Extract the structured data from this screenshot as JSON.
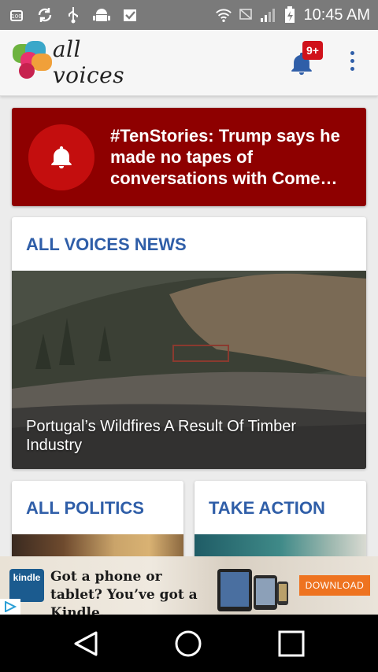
{
  "status_bar": {
    "time": "10:45 AM",
    "left_icons": [
      "battery-100-icon",
      "sync-icon",
      "usb-icon",
      "android-debug-icon",
      "clipboard-check-icon"
    ],
    "right_icons": [
      "wifi-icon",
      "no-sim-icon",
      "signal-icon",
      "battery-charging-icon"
    ]
  },
  "app_bar": {
    "logo_text": "all voices",
    "notification_badge": "9+"
  },
  "breaking": {
    "headline": "#TenStories: Trump says he made no tapes of conversations with Come…"
  },
  "sections": {
    "news": {
      "title": "ALL VOICES NEWS",
      "caption": "Portugal’s Wildfires A Result Of Timber Industry"
    },
    "politics": {
      "title": "ALL POLITICS"
    },
    "action": {
      "title": "TAKE ACTION"
    }
  },
  "ad": {
    "brand": "kindle",
    "text": "Got a phone or tablet? You’ve got a Kindle.",
    "cta": "DOWNLOAD"
  },
  "colors": {
    "accent": "#2f5ea8",
    "breaking_bg": "#8e0000",
    "badge": "#d0121b",
    "ad_cta": "#ee7320"
  }
}
